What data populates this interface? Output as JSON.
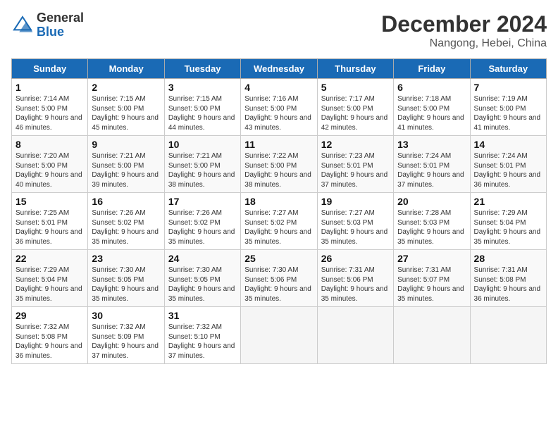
{
  "logo": {
    "line1": "General",
    "line2": "Blue"
  },
  "title": "December 2024",
  "location": "Nangong, Hebei, China",
  "days_of_week": [
    "Sunday",
    "Monday",
    "Tuesday",
    "Wednesday",
    "Thursday",
    "Friday",
    "Saturday"
  ],
  "weeks": [
    [
      {
        "day": "1",
        "sunrise": "7:14 AM",
        "sunset": "5:00 PM",
        "daylight": "9 hours and 46 minutes."
      },
      {
        "day": "2",
        "sunrise": "7:15 AM",
        "sunset": "5:00 PM",
        "daylight": "9 hours and 45 minutes."
      },
      {
        "day": "3",
        "sunrise": "7:15 AM",
        "sunset": "5:00 PM",
        "daylight": "9 hours and 44 minutes."
      },
      {
        "day": "4",
        "sunrise": "7:16 AM",
        "sunset": "5:00 PM",
        "daylight": "9 hours and 43 minutes."
      },
      {
        "day": "5",
        "sunrise": "7:17 AM",
        "sunset": "5:00 PM",
        "daylight": "9 hours and 42 minutes."
      },
      {
        "day": "6",
        "sunrise": "7:18 AM",
        "sunset": "5:00 PM",
        "daylight": "9 hours and 41 minutes."
      },
      {
        "day": "7",
        "sunrise": "7:19 AM",
        "sunset": "5:00 PM",
        "daylight": "9 hours and 41 minutes."
      }
    ],
    [
      {
        "day": "8",
        "sunrise": "7:20 AM",
        "sunset": "5:00 PM",
        "daylight": "9 hours and 40 minutes."
      },
      {
        "day": "9",
        "sunrise": "7:21 AM",
        "sunset": "5:00 PM",
        "daylight": "9 hours and 39 minutes."
      },
      {
        "day": "10",
        "sunrise": "7:21 AM",
        "sunset": "5:00 PM",
        "daylight": "9 hours and 38 minutes."
      },
      {
        "day": "11",
        "sunrise": "7:22 AM",
        "sunset": "5:00 PM",
        "daylight": "9 hours and 38 minutes."
      },
      {
        "day": "12",
        "sunrise": "7:23 AM",
        "sunset": "5:01 PM",
        "daylight": "9 hours and 37 minutes."
      },
      {
        "day": "13",
        "sunrise": "7:24 AM",
        "sunset": "5:01 PM",
        "daylight": "9 hours and 37 minutes."
      },
      {
        "day": "14",
        "sunrise": "7:24 AM",
        "sunset": "5:01 PM",
        "daylight": "9 hours and 36 minutes."
      }
    ],
    [
      {
        "day": "15",
        "sunrise": "7:25 AM",
        "sunset": "5:01 PM",
        "daylight": "9 hours and 36 minutes."
      },
      {
        "day": "16",
        "sunrise": "7:26 AM",
        "sunset": "5:02 PM",
        "daylight": "9 hours and 35 minutes."
      },
      {
        "day": "17",
        "sunrise": "7:26 AM",
        "sunset": "5:02 PM",
        "daylight": "9 hours and 35 minutes."
      },
      {
        "day": "18",
        "sunrise": "7:27 AM",
        "sunset": "5:02 PM",
        "daylight": "9 hours and 35 minutes."
      },
      {
        "day": "19",
        "sunrise": "7:27 AM",
        "sunset": "5:03 PM",
        "daylight": "9 hours and 35 minutes."
      },
      {
        "day": "20",
        "sunrise": "7:28 AM",
        "sunset": "5:03 PM",
        "daylight": "9 hours and 35 minutes."
      },
      {
        "day": "21",
        "sunrise": "7:29 AM",
        "sunset": "5:04 PM",
        "daylight": "9 hours and 35 minutes."
      }
    ],
    [
      {
        "day": "22",
        "sunrise": "7:29 AM",
        "sunset": "5:04 PM",
        "daylight": "9 hours and 35 minutes."
      },
      {
        "day": "23",
        "sunrise": "7:30 AM",
        "sunset": "5:05 PM",
        "daylight": "9 hours and 35 minutes."
      },
      {
        "day": "24",
        "sunrise": "7:30 AM",
        "sunset": "5:05 PM",
        "daylight": "9 hours and 35 minutes."
      },
      {
        "day": "25",
        "sunrise": "7:30 AM",
        "sunset": "5:06 PM",
        "daylight": "9 hours and 35 minutes."
      },
      {
        "day": "26",
        "sunrise": "7:31 AM",
        "sunset": "5:06 PM",
        "daylight": "9 hours and 35 minutes."
      },
      {
        "day": "27",
        "sunrise": "7:31 AM",
        "sunset": "5:07 PM",
        "daylight": "9 hours and 35 minutes."
      },
      {
        "day": "28",
        "sunrise": "7:31 AM",
        "sunset": "5:08 PM",
        "daylight": "9 hours and 36 minutes."
      }
    ],
    [
      {
        "day": "29",
        "sunrise": "7:32 AM",
        "sunset": "5:08 PM",
        "daylight": "9 hours and 36 minutes."
      },
      {
        "day": "30",
        "sunrise": "7:32 AM",
        "sunset": "5:09 PM",
        "daylight": "9 hours and 37 minutes."
      },
      {
        "day": "31",
        "sunrise": "7:32 AM",
        "sunset": "5:10 PM",
        "daylight": "9 hours and 37 minutes."
      },
      null,
      null,
      null,
      null
    ]
  ]
}
